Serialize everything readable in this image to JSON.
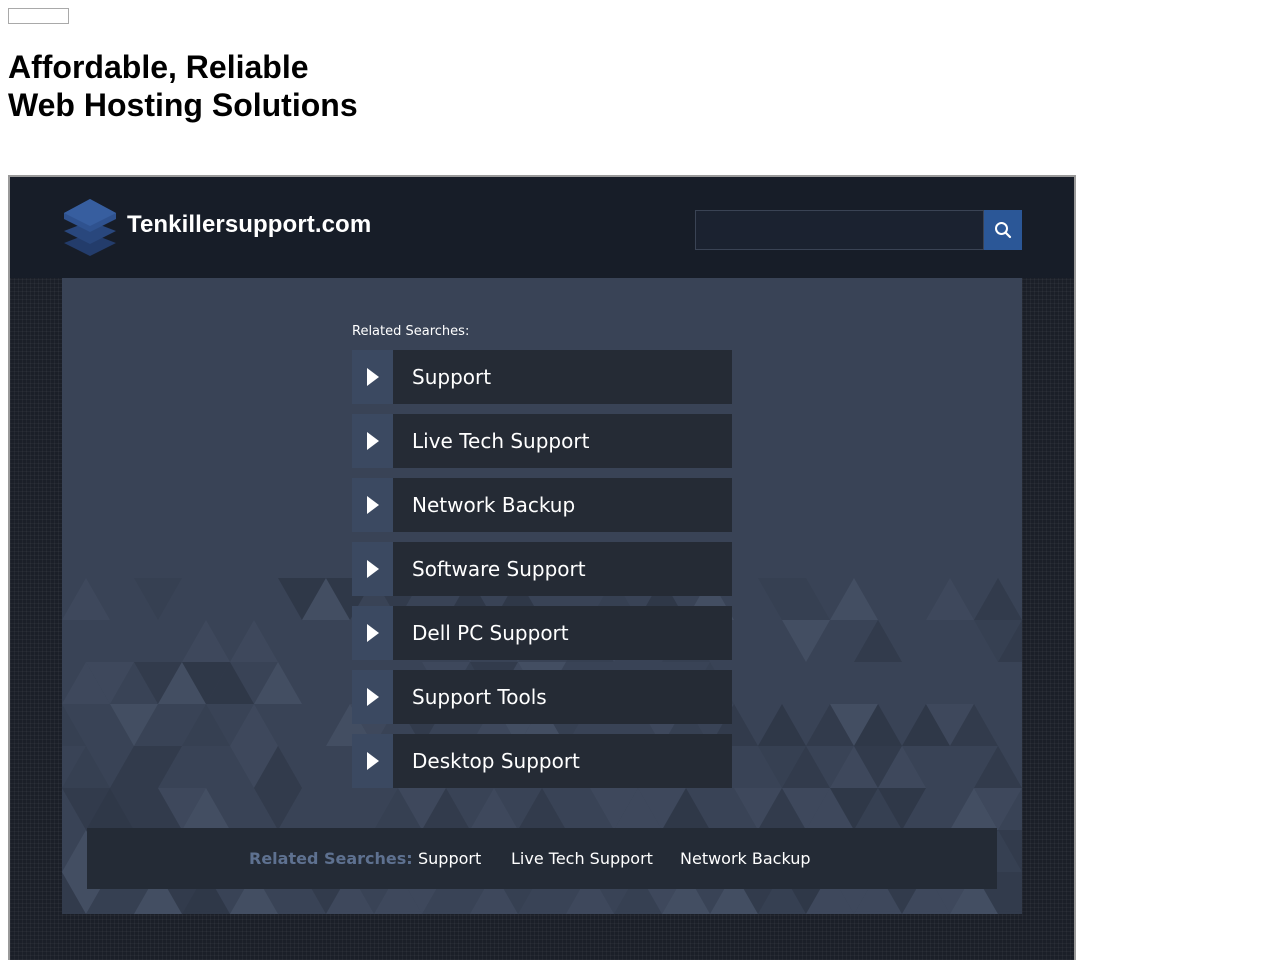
{
  "hero": {
    "line1": "Affordable, Reliable",
    "line2": "Web Hosting Solutions"
  },
  "header": {
    "site_name": "Tenkillersupport.com",
    "logo_icon": "stacked-layers-icon",
    "search": {
      "value": "",
      "placeholder": "",
      "button_icon": "search-icon"
    }
  },
  "related": {
    "label": "Related Searches:",
    "items": [
      {
        "label": "Support"
      },
      {
        "label": "Live Tech Support"
      },
      {
        "label": "Network Backup"
      },
      {
        "label": "Software Support"
      },
      {
        "label": "Dell PC Support"
      },
      {
        "label": "Support Tools"
      },
      {
        "label": "Desktop Support"
      }
    ]
  },
  "footer": {
    "label": "Related Searches:",
    "links": [
      {
        "label": "Support"
      },
      {
        "label": "Live Tech Support"
      },
      {
        "label": "Network Backup"
      }
    ]
  },
  "colors": {
    "frame_bg": "#1b1f28",
    "header_bg": "#171d28",
    "panel_bg": "#394356",
    "item_bg": "#252b35",
    "arrow_bg": "#3b4961",
    "search_button": "#2b5797",
    "footer_label": "#5e7190"
  }
}
